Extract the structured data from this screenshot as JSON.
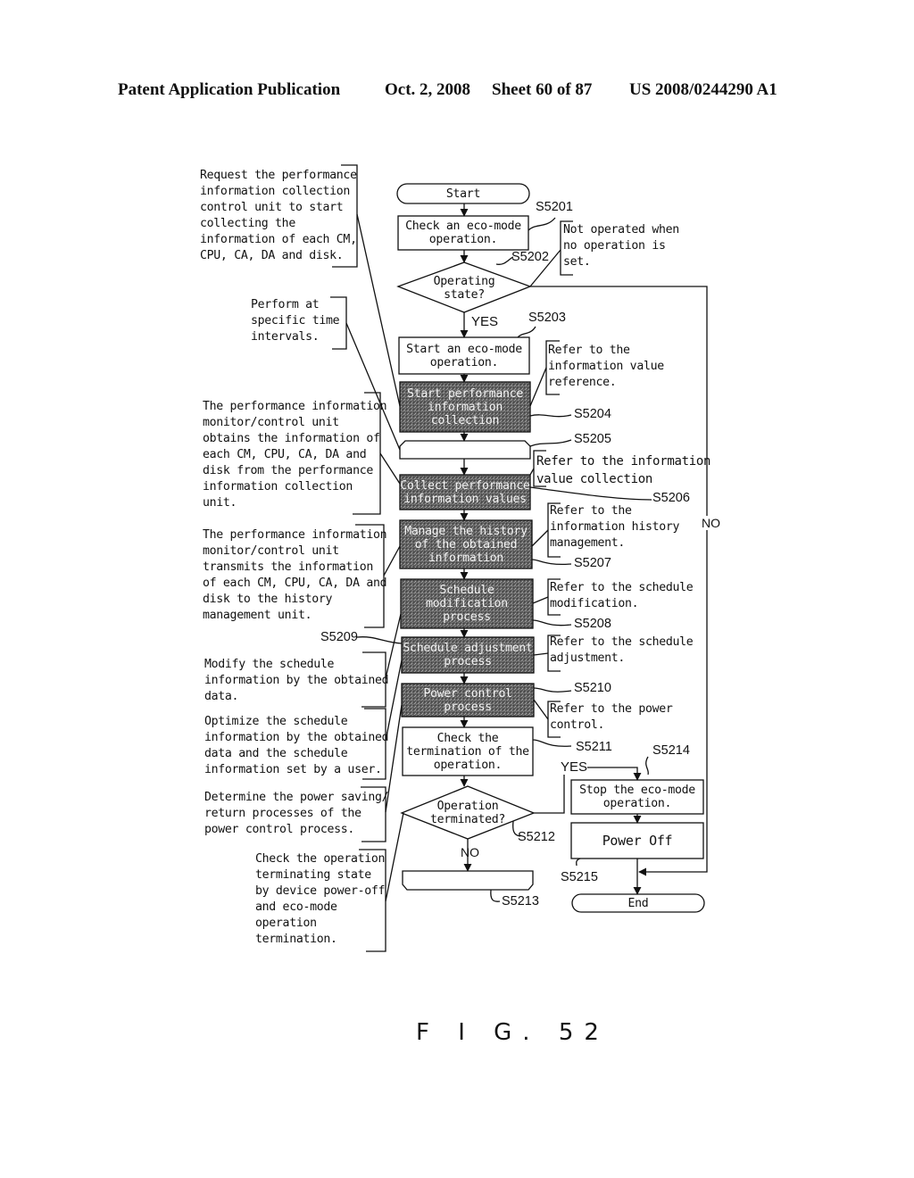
{
  "header": {
    "publication": "Patent Application Publication",
    "date": "Oct. 2, 2008",
    "sheet": "Sheet 60 of 87",
    "number": "US 2008/0244290 A1"
  },
  "figure_label": "F I G. 52",
  "colors": {
    "line": "#111111",
    "shaded_box": "#5a5a5a",
    "paper": "#ffffff"
  },
  "flowchart": {
    "nodes": {
      "start": "Start",
      "check_eco": "Check an eco-mode\noperation.",
      "operating_state": "Operating\nstate?",
      "start_eco": "Start an eco-mode\noperation.",
      "start_perf": "Start performance\ninformation\ncollection",
      "loop_start": "",
      "collect_perf": "Collect performance\ninformation values",
      "manage_history": "Manage the history\nof the obtained\ninformation",
      "schedule_mod": "Schedule\nmodification\nprocess",
      "schedule_adj": "Schedule adjustment\nprocess",
      "power_control": "Power control\nprocess",
      "check_termination": "Check the\ntermination of the\noperation.",
      "operation_terminated": "Operation\nterminated?",
      "loop_end": "",
      "stop_eco": "Stop the eco-mode\noperation.",
      "power_off": "Power Off",
      "end": "End"
    },
    "branch_labels": {
      "yes_1": "YES",
      "no_1": "NO",
      "yes_2": "YES",
      "no_2": "NO"
    },
    "step_ids": {
      "s5201": "S5201",
      "s5202": "S5202",
      "s5203": "S5203",
      "s5204": "S5204",
      "s5205": "S5205",
      "s5206": "S5206",
      "s5207": "S5207",
      "s5208": "S5208",
      "s5209": "S5209",
      "s5210": "S5210",
      "s5211": "S5211",
      "s5212": "S5212",
      "s5213": "S5213",
      "s5214": "S5214",
      "s5215": "S5215"
    }
  },
  "left_notes": {
    "request_collection": "Request the performance\ninformation collection\ncontrol unit to start\ncollecting the\ninformation of each CM,\nCPU, CA, DA and disk.",
    "time_intervals": "Perform at\nspecific time\nintervals.",
    "obtains_info": "The performance information\nmonitor/control unit\nobtains the information of\neach CM, CPU, CA, DA and\ndisk from the performance\ninformation collection\nunit.",
    "transmits_info": "The performance information\nmonitor/control unit\ntransmits the information\nof each CM, CPU, CA, DA and\ndisk to the history\nmanagement unit.",
    "modify_schedule": "Modify the schedule\ninformation by the obtained\ndata.",
    "optimize_schedule": "Optimize the schedule\ninformation by the obtained\ndata and the schedule\ninformation set by a user.",
    "determine_power": "Determine the power saving/\nreturn processes of the\npower control process.",
    "check_terminating": "Check the operation\nterminating state\nby device power-off\nand eco-mode\noperation\ntermination."
  },
  "right_notes": {
    "not_operated": "Not operated when\nno operation is\nset.",
    "value_reference": "Refer to the\ninformation value\nreference.",
    "value_collection": "Refer to the information\nvalue collection",
    "history_management": "Refer to the\ninformation history\nmanagement.",
    "schedule_modification": "Refer to the schedule\nmodification.",
    "schedule_adjustment": "Refer to the schedule\nadjustment.",
    "power_control": "Refer to the power\ncontrol."
  }
}
